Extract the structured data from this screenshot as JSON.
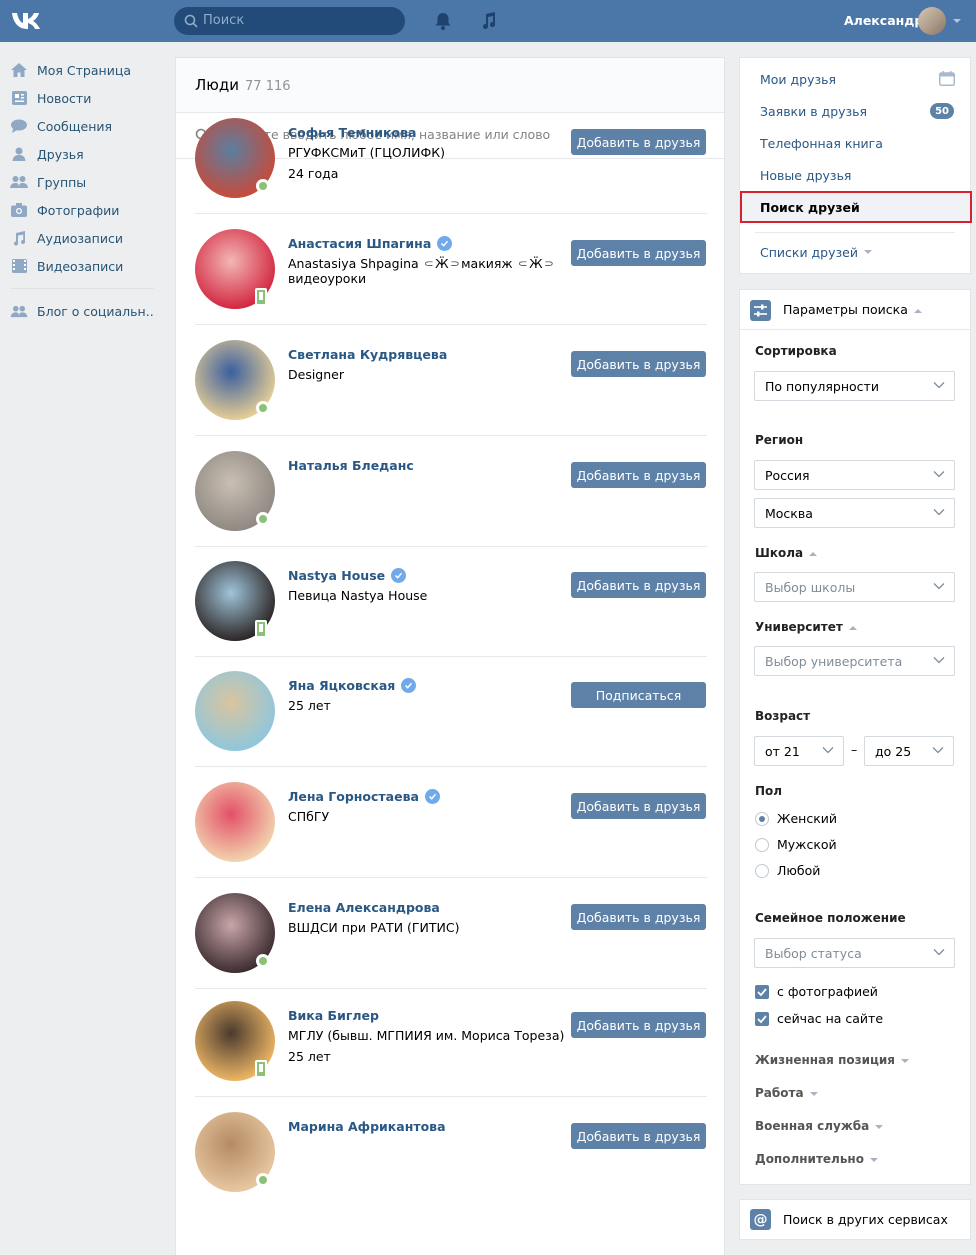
{
  "header": {
    "search_placeholder": "Поиск",
    "user_name": "Александр"
  },
  "leftnav": {
    "items": [
      {
        "label": "Моя Страница",
        "icon": "home-icon"
      },
      {
        "label": "Новости",
        "icon": "news-icon"
      },
      {
        "label": "Сообщения",
        "icon": "messages-icon"
      },
      {
        "label": "Друзья",
        "icon": "friends-icon"
      },
      {
        "label": "Группы",
        "icon": "groups-icon"
      },
      {
        "label": "Фотографии",
        "icon": "camera-icon"
      },
      {
        "label": "Аудиозаписи",
        "icon": "music-icon"
      },
      {
        "label": "Видеозаписи",
        "icon": "video-icon"
      }
    ],
    "extra": {
      "label": "Блог о социальн..",
      "icon": "group-icon"
    }
  },
  "main": {
    "title": "Люди",
    "count": "77 116",
    "search_placeholder": "Начните вводить любое имя, название или слово",
    "people": [
      {
        "name": "Софья Темникова",
        "info": "РГУФКСМиТ (ГЦОЛИФК)",
        "info2": "24 года",
        "button": "Добавить в друзья",
        "verified": false,
        "status": "online",
        "colors": [
          "#c84a3a",
          "#5a7fa0"
        ]
      },
      {
        "name": "Анастасия Шпагина",
        "info": "Anastasiya Shpagina ⸦Ӝ⸧макияж ⸦Ӝ⸧видеоуроки",
        "info2": "",
        "button": "Добавить в друзья",
        "verified": true,
        "status": "mobile",
        "colors": [
          "#d2253f",
          "#f2b7b4"
        ]
      },
      {
        "name": "Светлана Кудрявцева",
        "info": "Designer",
        "info2": "",
        "button": "Добавить в друзья",
        "verified": false,
        "status": "online",
        "colors": [
          "#e8cf95",
          "#3b5fa0"
        ]
      },
      {
        "name": "Наталья Бледанс",
        "info": "",
        "info2": "",
        "button": "Добавить в друзья",
        "verified": false,
        "status": "online",
        "colors": [
          "#8e8881",
          "#c9bfb4"
        ]
      },
      {
        "name": "Nastya House",
        "info": "Певица Nastya House",
        "info2": "",
        "button": "Добавить в друзья",
        "verified": true,
        "status": "mobile",
        "colors": [
          "#2b2422",
          "#9fc4da"
        ]
      },
      {
        "name": "Яна Яцковская",
        "info": "25 лет",
        "info2": "",
        "button": "Подписаться",
        "verified": true,
        "status": "none",
        "colors": [
          "#8fc6dd",
          "#d9c59e"
        ]
      },
      {
        "name": "Лена Горностаева",
        "info": "СПбГУ",
        "info2": "",
        "button": "Добавить в друзья",
        "verified": true,
        "status": "none",
        "colors": [
          "#f2d6b0",
          "#e35068"
        ]
      },
      {
        "name": "Елена Александрова",
        "info": "ВШДСИ при РАТИ (ГИТИС)",
        "info2": "",
        "button": "Добавить в друзья",
        "verified": false,
        "status": "online",
        "colors": [
          "#3a2a2e",
          "#c9a6a8"
        ]
      },
      {
        "name": "Вика Биглер",
        "info": "МГЛУ (бывш. МГПИИЯ им. Мориса Тореза)",
        "info2": "25 лет",
        "button": "Добавить в друзья",
        "verified": false,
        "status": "mobile",
        "colors": [
          "#f0b866",
          "#4a3a2e"
        ]
      },
      {
        "name": "Марина Африкантова",
        "info": "",
        "info2": "",
        "button": "Добавить в друзья",
        "verified": false,
        "status": "online",
        "colors": [
          "#e8c8a2",
          "#b48a63"
        ]
      }
    ]
  },
  "right": {
    "items": [
      {
        "label": "Мои друзья"
      },
      {
        "label": "Заявки в друзья",
        "badge": "50"
      },
      {
        "label": "Телефонная книга"
      },
      {
        "label": "Новые друзья"
      },
      {
        "label": "Поиск друзей"
      }
    ],
    "lists_label": "Списки друзей"
  },
  "params": {
    "title": "Параметры поиска",
    "sort_label": "Сортировка",
    "sort_value": "По популярности",
    "region_label": "Регион",
    "country_value": "Россия",
    "city_value": "Москва",
    "school_label": "Школа",
    "school_placeholder": "Выбор школы",
    "university_label": "Университет",
    "university_placeholder": "Выбор университета",
    "age_label": "Возраст",
    "age_from": "от 21",
    "age_dash": "–",
    "age_to": "до 25",
    "sex_label": "Пол",
    "sex_options": [
      "Женский",
      "Мужской",
      "Любой"
    ],
    "family_label": "Семейное положение",
    "family_placeholder": "Выбор статуса",
    "with_photo": "с фотографией",
    "online_now": "сейчас на сайте",
    "life_position": "Жизненная позиция",
    "work": "Работа",
    "military": "Военная служба",
    "additional": "Дополнительно"
  },
  "other_services": {
    "label": "Поиск в других сервисах",
    "icon_glyph": "@"
  },
  "colors": {
    "header": "#4a76a8",
    "link": "#2a5885",
    "button": "#5e81a8",
    "online": "#8ac176",
    "highlight": "#d4232c"
  }
}
